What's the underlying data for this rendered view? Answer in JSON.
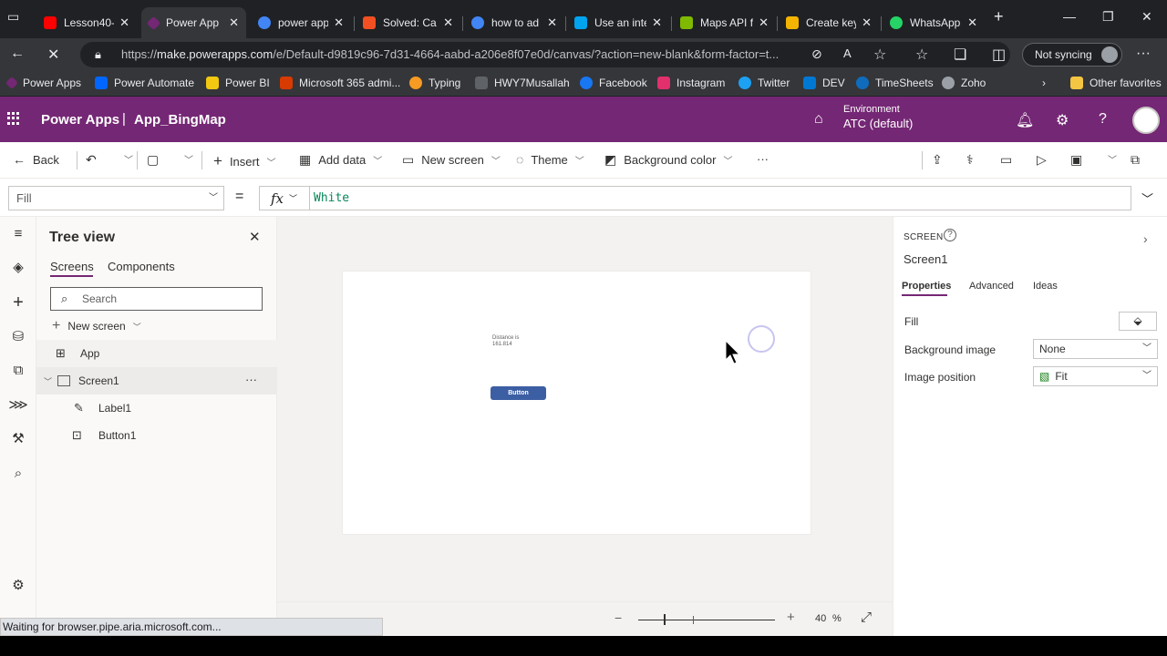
{
  "browser": {
    "tabs": [
      {
        "title": "Lesson40-",
        "color": "#ff0000"
      },
      {
        "title": "Power App",
        "color": "#742774"
      },
      {
        "title": "power app",
        "color": "#4285f4"
      },
      {
        "title": "Solved: Ca",
        "color": "#f25022"
      },
      {
        "title": "how to ad",
        "color": "#4285f4"
      },
      {
        "title": "Use an inte",
        "color": "#00a4ef"
      },
      {
        "title": "Maps API f",
        "color": "#7fba00"
      },
      {
        "title": "Create key",
        "color": "#f4b400"
      },
      {
        "title": "WhatsApp",
        "color": "#25d366"
      }
    ],
    "url_host": "make.powerapps.com",
    "url_rest": "/e/Default-d9819c96-7d31-4664-aabd-a206e8f07e0d/canvas/?action=new-blank&form-factor=t...",
    "url_prefix": "https://",
    "sync_label": "Not syncing",
    "bookmarks": [
      {
        "label": "Power Apps",
        "color": "#742774"
      },
      {
        "label": "Power Automate",
        "color": "#0066ff"
      },
      {
        "label": "Power BI",
        "color": "#f2c811"
      },
      {
        "label": "Microsoft 365 admi...",
        "color": "#d83b01"
      },
      {
        "label": "Typing",
        "color": "#f59a23"
      },
      {
        "label": "HWY7Musallah",
        "color": "#5f6368"
      },
      {
        "label": "Facebook",
        "color": "#1877f2"
      },
      {
        "label": "Instagram",
        "color": "#e1306c"
      },
      {
        "label": "Twitter",
        "color": "#1da1f2"
      },
      {
        "label": "DEV",
        "color": "#0078d4"
      },
      {
        "label": "TimeSheets",
        "color": "#0f6cbd"
      },
      {
        "label": "Zoho",
        "color": "#9aa0a6"
      }
    ],
    "other_favorites": "Other favorites"
  },
  "app": {
    "product": "Power Apps",
    "separator": "|",
    "name": "App_BingMap",
    "environment_label": "Environment",
    "environment_value": "ATC (default)"
  },
  "command_bar": {
    "back": "Back",
    "insert": "Insert",
    "add_data": "Add data",
    "new_screen": "New screen",
    "theme": "Theme",
    "background_color": "Background color",
    "more": "···"
  },
  "formula_bar": {
    "property": "Fill",
    "equals": "=",
    "fx": "fx",
    "formula": "White"
  },
  "tree_view": {
    "title": "Tree view",
    "tabs": [
      "Screens",
      "Components"
    ],
    "search_placeholder": "Search",
    "new_screen": "New screen",
    "items": [
      {
        "label": "App"
      },
      {
        "label": "Screen1"
      },
      {
        "label": "Label1"
      },
      {
        "label": "Button1"
      }
    ]
  },
  "canvas": {
    "label_line1": "Distance is",
    "label_line2": "161.814",
    "button_text": "Button"
  },
  "zoom": {
    "value": "40",
    "unit": "%",
    "slider_fraction": 0.4
  },
  "properties": {
    "type_label": "SCREEN",
    "name": "Screen1",
    "tabs": [
      "Properties",
      "Advanced",
      "Ideas"
    ],
    "fill_label": "Fill",
    "background_image_label": "Background image",
    "background_image_value": "None",
    "image_position_label": "Image position",
    "image_position_value": "Fit"
  },
  "status": "Waiting for browser.pipe.aria.microsoft.com..."
}
